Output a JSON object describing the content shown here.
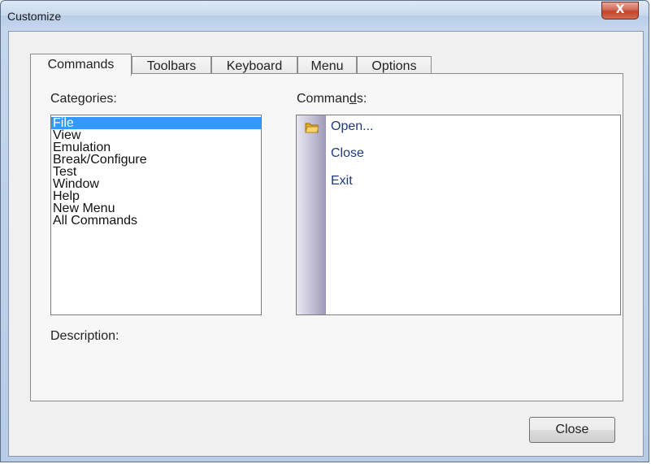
{
  "window": {
    "title": "Customize",
    "close_glyph": "X"
  },
  "tabs": [
    {
      "label": "Commands",
      "active": true
    },
    {
      "label": "Toolbars",
      "active": false
    },
    {
      "label": "Keyboard",
      "active": false
    },
    {
      "label": "Menu",
      "active": false
    },
    {
      "label": "Options",
      "active": false
    }
  ],
  "categories": {
    "label_pre": "Cate",
    "label_mnemonic": "g",
    "label_post": "ories:",
    "items": [
      "File",
      "View",
      "Emulation",
      "Break/Configure",
      "Test",
      "Window",
      "Help",
      "New Menu",
      "All Commands"
    ],
    "selected": "File"
  },
  "commands": {
    "label_pre": "Comman",
    "label_mnemonic": "d",
    "label_post": "s:",
    "items": [
      {
        "label": "Open...",
        "icon": "folder-open-icon"
      },
      {
        "label": "Close",
        "icon": ""
      },
      {
        "label": "Exit",
        "icon": ""
      }
    ]
  },
  "description": {
    "label": "Description:"
  },
  "footer": {
    "close_button": "Close"
  },
  "colors": {
    "selection": "#3399ff",
    "command_text": "#1e3a7a"
  }
}
